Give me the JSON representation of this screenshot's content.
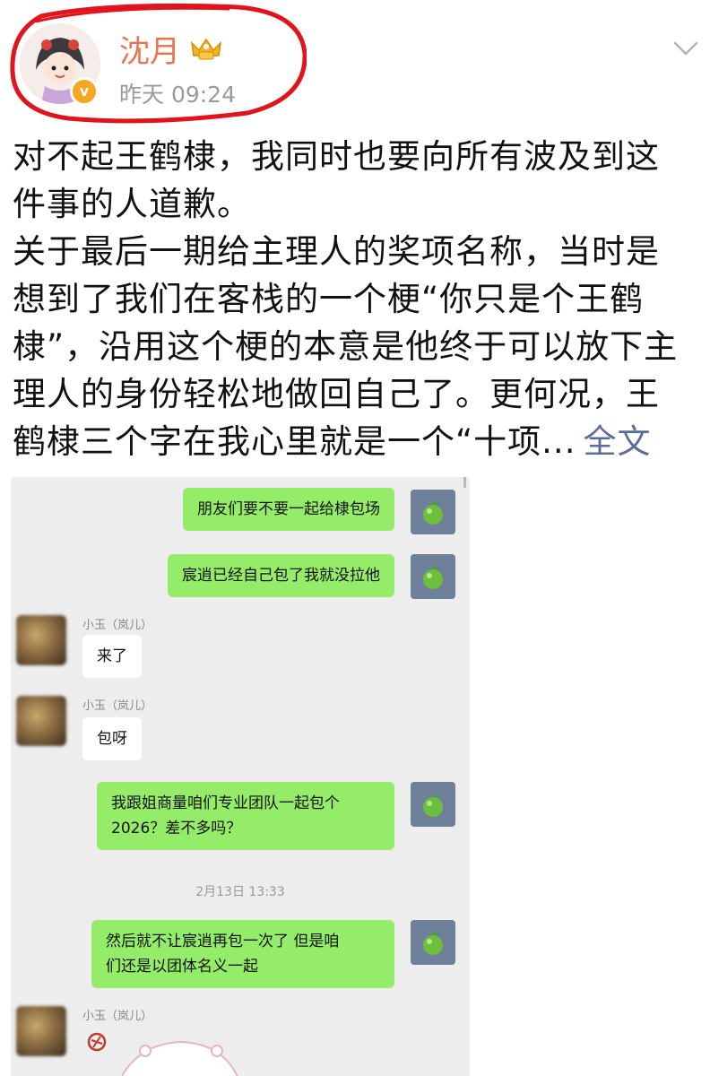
{
  "post": {
    "author": "沈月",
    "time": "昨天 09:24",
    "text_lines": [
      "对不起王鹤棣，我同时也要向所有波及到这",
      "件事的人道歉。",
      "关于最后一期给主理人的奖项名称，当时是",
      "想到了我们在客栈的一个梗“你只是个王鹤",
      "棣”，沿用这个梗的本意是他终于可以放下主",
      "理人的身份轻松地做回自己了。更何况，王"
    ],
    "last_line": "鹤棣三个字在我心里就是一个“十项...",
    "full_text_link": "全文"
  },
  "chat": {
    "messages": [
      {
        "from": "me",
        "text": "朋友们要不要一起给棣包场"
      },
      {
        "from": "me",
        "text": "宸逍已经自己包了我就没拉他"
      },
      {
        "from": "them",
        "sender": "小玉（岚儿）",
        "text": "来了"
      },
      {
        "from": "them",
        "sender": "小玉（岚儿）",
        "text": "包呀"
      },
      {
        "from": "me",
        "text_lines": [
          "我跟姐商量咱们专业团队一起包个",
          "2026？差不多吗？"
        ]
      },
      {
        "from": "me",
        "text_lines": [
          "然后就不让宸逍再包一次了 但是咱",
          "们还是以团体名义一起"
        ]
      },
      {
        "from": "them",
        "sender": "小玉（岚儿）",
        "text": ""
      }
    ],
    "timestamp": "2月13日 13:33"
  },
  "colors": {
    "username": "#eb7350",
    "link": "#5b6c9a",
    "bubble_me": "#95ec69",
    "bubble_them": "#ffffff",
    "chat_bg": "#ededed",
    "highlight_circle": "#e0141c"
  },
  "icons": [
    "avatar",
    "verified-badge-icon",
    "vip-crown-icon",
    "chevron-down-icon",
    "apple-avatar-icon",
    "sticker-image"
  ]
}
